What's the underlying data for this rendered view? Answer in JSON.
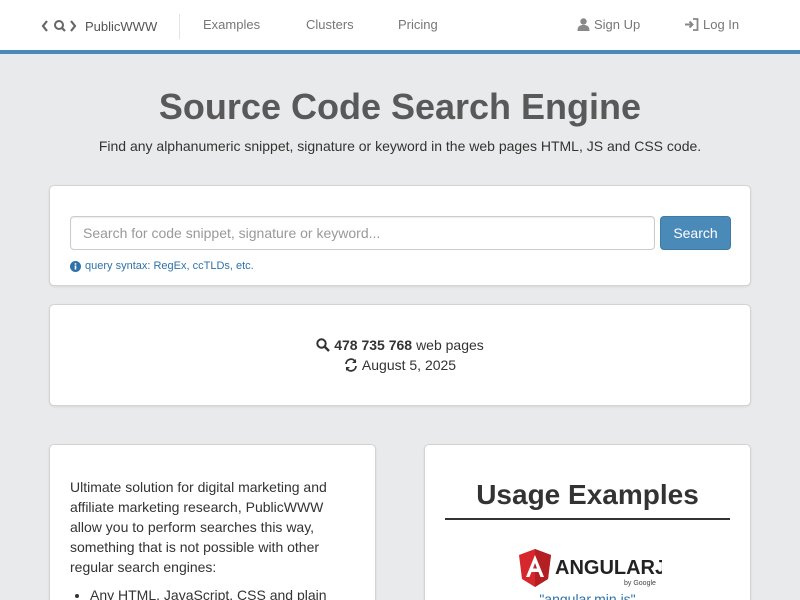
{
  "nav": {
    "brand": "PublicWWW",
    "links": [
      "Examples",
      "Clusters",
      "Pricing"
    ],
    "signup": "Sign Up",
    "login": "Log In"
  },
  "hero": {
    "title": "Source Code Search Engine",
    "subtitle": "Find any alphanumeric snippet, signature or keyword in the web pages HTML, JS and CSS code."
  },
  "search": {
    "placeholder": "Search for code snippet, signature or keyword...",
    "button": "Search",
    "syntax_link": "query syntax: RegEx, ccTLDs, etc."
  },
  "stats": {
    "count": "478 735 768",
    "count_label": "web pages",
    "date": "August 5, 2025"
  },
  "description": {
    "text": "Ultimate solution for digital marketing and affiliate marketing research, PublicWWW allow you to perform searches this way, something that is not possible with other regular search engines:",
    "list": [
      "Any HTML, JavaScript, CSS and plain"
    ]
  },
  "usage": {
    "title": "Usage Examples",
    "logo_text": "ANGULARJS",
    "logo_by": "by Google",
    "example_link": "\"angular.min.js\""
  },
  "colors": {
    "accent": "#4a8ab8",
    "link": "#2f72a8",
    "angular_red": "#d6282c"
  }
}
